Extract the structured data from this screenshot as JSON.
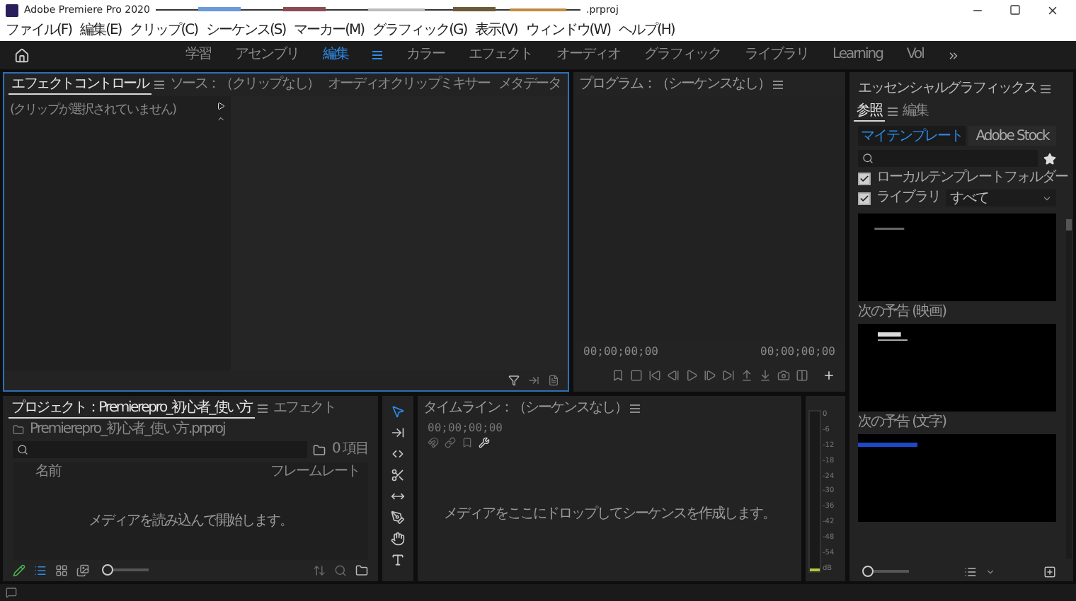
{
  "window": {
    "title": "Adobe Premiere Pro 2020",
    "file_suffix": ".prproj"
  },
  "menu": [
    "ファイル(F)",
    "編集(E)",
    "クリップ(C)",
    "シーケンス(S)",
    "マーカー(M)",
    "グラフィック(G)",
    "表示(V)",
    "ウィンドウ(W)",
    "ヘルプ(H)"
  ],
  "workspaces": [
    {
      "label": "学習",
      "selected": false
    },
    {
      "label": "アセンブリ",
      "selected": false
    },
    {
      "label": "編集",
      "selected": true
    },
    {
      "label": "カラー",
      "selected": false
    },
    {
      "label": "エフェクト",
      "selected": false
    },
    {
      "label": "オーディオ",
      "selected": false
    },
    {
      "label": "グラフィック",
      "selected": false
    },
    {
      "label": "ライブラリ",
      "selected": false
    },
    {
      "label": "Learning",
      "selected": false
    },
    {
      "label": "Vol",
      "selected": false
    }
  ],
  "effect_panel": {
    "focused": true,
    "tabs": [
      {
        "label": "エフェクトコントロール",
        "selected": true
      },
      {
        "label": "ソース：（クリップなし）",
        "selected": false
      },
      {
        "label": "オーディオクリップミキサー",
        "selected": false
      },
      {
        "label": "メタデータ",
        "selected": false
      }
    ],
    "message": "(クリップが選択されていません)"
  },
  "program_monitor": {
    "title": "プログラム：（シーケンスなし）",
    "timecode_left": "00;00;00;00",
    "timecode_right": "00;00;00;00"
  },
  "project_panel": {
    "tabs": [
      {
        "label": "プロジェクト：Premierepro_初心者_使い方",
        "selected": true
      },
      {
        "label": "エフェクト",
        "selected": false
      }
    ],
    "file": "Premierepro_初心者_使い方.prproj",
    "item_count": "0 項目",
    "columns": [
      "名前",
      "フレームレート"
    ],
    "empty_message": "メディアを読み込んで開始します。",
    "zoom": {
      "level": 0.1
    }
  },
  "tools": [
    {
      "kind": "selection",
      "selected": true
    },
    {
      "kind": "track-select",
      "selected": false
    },
    {
      "kind": "ripple",
      "selected": false
    },
    {
      "kind": "razor",
      "selected": false
    },
    {
      "kind": "slip",
      "selected": false
    },
    {
      "kind": "pen",
      "selected": false
    },
    {
      "kind": "hand",
      "selected": false
    },
    {
      "kind": "type",
      "selected": false
    }
  ],
  "timeline": {
    "title": "タイムライン：（シーケンスなし）",
    "timecode": "00;00;00;00",
    "empty_message": "メディアをここにドロップしてシーケンスを作成します。"
  },
  "audio_meter": {
    "scale": [
      "0",
      "-6",
      "-12",
      "-18",
      "-24",
      "-30",
      "-36",
      "-42",
      "-48",
      "-54",
      "dB"
    ]
  },
  "essential_graphics": {
    "title": "エッセンシャルグラフィックス",
    "tabs": [
      {
        "label": "参照",
        "selected": true
      },
      {
        "label": "編集",
        "selected": false
      }
    ],
    "sources": [
      {
        "label": "マイテンプレート",
        "selected": true
      },
      {
        "label": "Adobe Stock",
        "selected": false
      }
    ],
    "filters": [
      {
        "label": "ローカルテンプレートフォルダー",
        "checked": true
      },
      {
        "label": "ライブラリ",
        "checked": true
      }
    ],
    "library_choice": "すべて",
    "templates": [
      {
        "kind": "grey-caption",
        "label": "次の予告 (映画)"
      },
      {
        "kind": "white-caption",
        "label": "次の予告 (文字)"
      },
      {
        "kind": "blue-bar"
      }
    ],
    "zoom": {
      "level": 0.1
    }
  }
}
